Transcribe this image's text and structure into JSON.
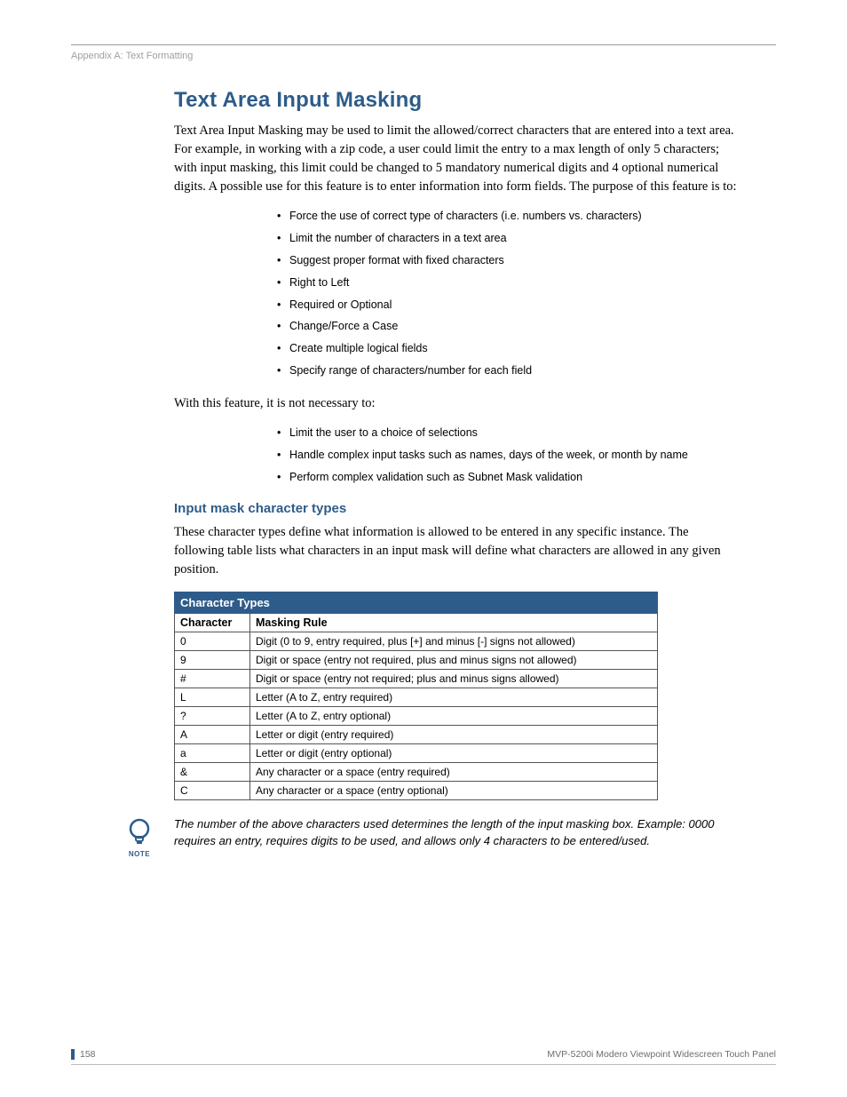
{
  "runningHead": "Appendix A: Text Formatting",
  "section": {
    "heading": "Text Area Input Masking",
    "para1": "Text Area Input Masking may be used to limit the allowed/correct characters that are entered into a text area. For example, in working with a zip code, a user could limit the entry to a max length of only 5 characters; with input masking, this limit could be changed to 5 mandatory numerical digits and 4 optional numerical digits. A possible use for this feature is to enter information into form fields. The purpose of this feature is to:",
    "purposeList": [
      "Force the use of correct type of characters (i.e. numbers vs. characters)",
      "Limit the number of characters in a text area",
      "Suggest proper format with fixed characters",
      "Right to Left",
      "Required or Optional",
      "Change/Force a Case",
      "Create multiple logical fields",
      "Specify range of characters/number for each field"
    ],
    "para2": "With this feature, it is not necessary to:",
    "notNecessaryList": [
      "Limit the user to a choice of selections",
      "Handle complex input tasks such as names, days of the week, or month by name",
      "Perform complex validation such as Subnet Mask validation"
    ]
  },
  "subsection": {
    "heading": "Input mask character types",
    "para": "These character types define what information is allowed to be entered in any specific instance. The following table lists what characters in an input mask will define what characters are allowed in any given position."
  },
  "table": {
    "title": "Character Types",
    "columns": [
      "Character",
      "Masking Rule"
    ],
    "rows": [
      {
        "c": "0",
        "r": "Digit (0 to 9, entry required, plus [+] and minus [-] signs not allowed)"
      },
      {
        "c": "9",
        "r": "Digit or space (entry not required, plus and minus signs not allowed)"
      },
      {
        "c": "#",
        "r": "Digit or space (entry not required; plus and minus signs allowed)"
      },
      {
        "c": "L",
        "r": "Letter (A to Z, entry required)"
      },
      {
        "c": "?",
        "r": "Letter (A to Z, entry optional)"
      },
      {
        "c": "A",
        "r": "Letter or digit (entry required)"
      },
      {
        "c": "a",
        "r": "Letter or digit (entry optional)"
      },
      {
        "c": "&",
        "r": "Any character or a space (entry required)"
      },
      {
        "c": "C",
        "r": "Any character or a space (entry optional)"
      }
    ]
  },
  "note": {
    "label": "NOTE",
    "text": "The number of the above characters used determines the length of the input masking box. Example: 0000 requires an entry, requires digits to be used, and allows only 4 characters to be entered/used."
  },
  "footer": {
    "page": "158",
    "doc": "MVP-5200i Modero Viewpoint Widescreen Touch Panel"
  }
}
